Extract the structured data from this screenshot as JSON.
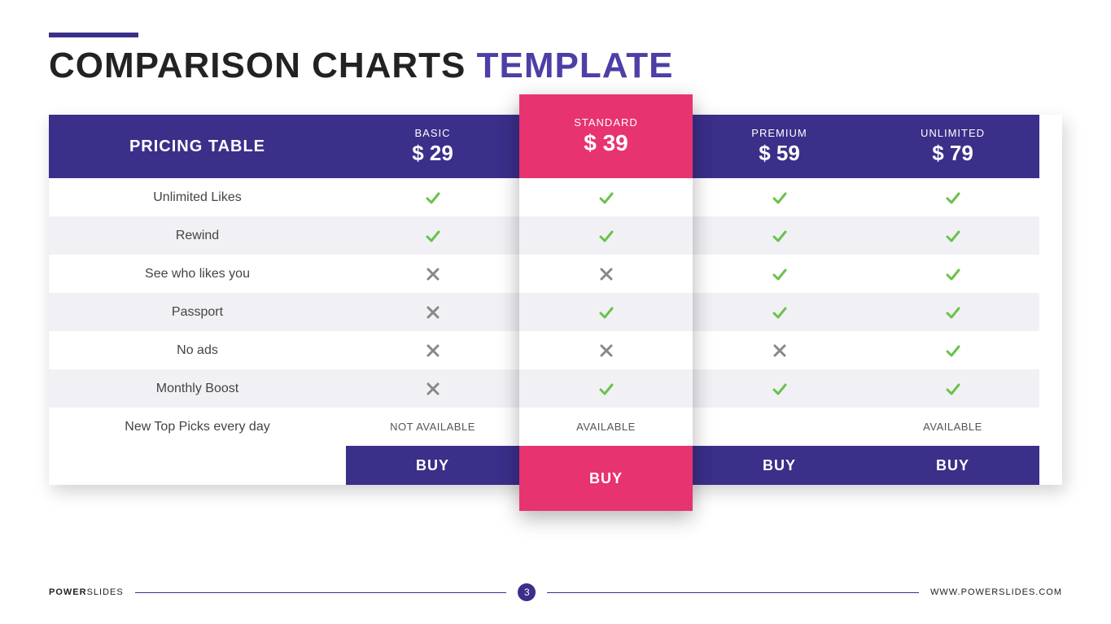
{
  "title": {
    "main": "COMPARISON CHARTS",
    "accent": "TEMPLATE"
  },
  "header_label": "PRICING TABLE",
  "chart_data": {
    "type": "table",
    "plans": [
      {
        "name": "BASIC",
        "price": "$ 29",
        "highlight": false
      },
      {
        "name": "STANDARD",
        "price": "$ 39",
        "highlight": true
      },
      {
        "name": "PREMIUM",
        "price": "$ 59",
        "highlight": false
      },
      {
        "name": "UNLIMITED",
        "price": "$ 79",
        "highlight": false
      }
    ],
    "features": [
      "Unlimited Likes",
      "Rewind",
      "See who likes you",
      "Passport",
      "No ads",
      "Monthly Boost",
      "New Top Picks every day"
    ],
    "matrix": [
      [
        "check",
        "check",
        "check",
        "check"
      ],
      [
        "check",
        "check",
        "check",
        "check"
      ],
      [
        "x",
        "x",
        "check",
        "check"
      ],
      [
        "x",
        "check",
        "check",
        "check"
      ],
      [
        "x",
        "x",
        "x",
        "check"
      ],
      [
        "x",
        "check",
        "check",
        "check"
      ],
      [
        "NOT AVAILABLE",
        "AVAILABLE",
        "",
        "AVAILABLE"
      ]
    ],
    "buy_label": "BUY"
  },
  "footer": {
    "brand_bold": "POWER",
    "brand_rest": "SLIDES",
    "page": "3",
    "site": "WWW.POWERSLIDES.COM"
  }
}
